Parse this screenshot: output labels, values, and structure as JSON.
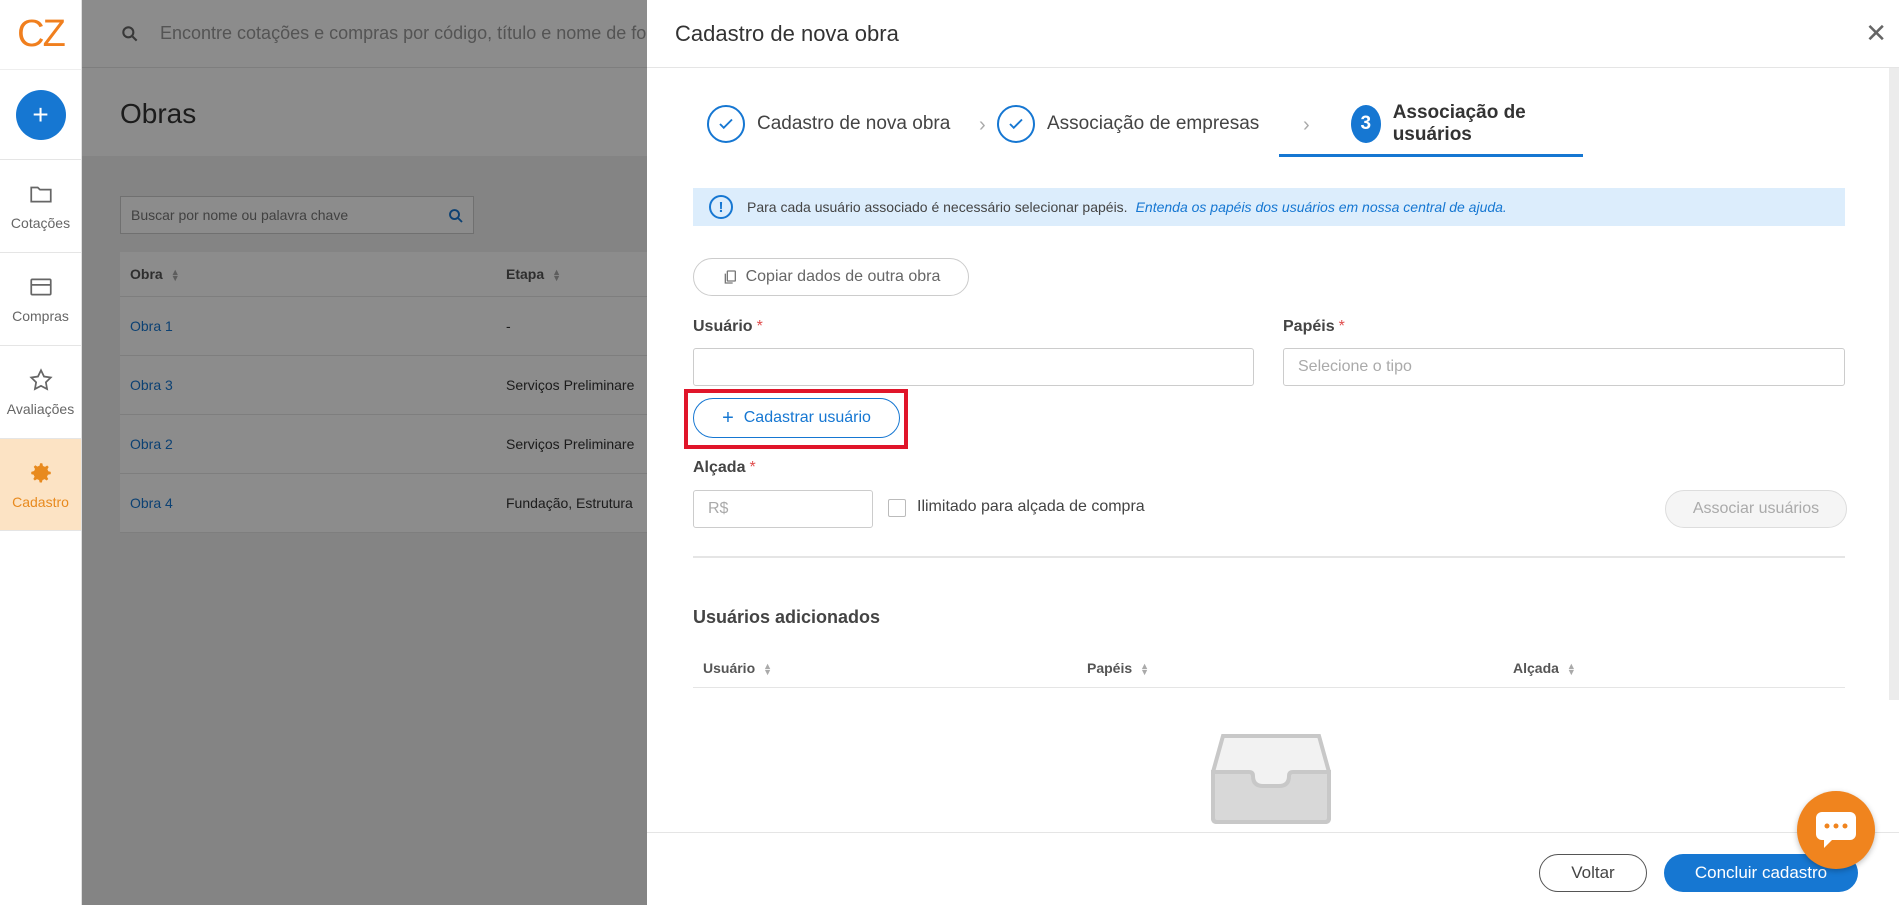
{
  "sidebar": {
    "logo": "CZ",
    "new_button": "+",
    "items": [
      {
        "label": "Cotações",
        "icon": "folder-icon"
      },
      {
        "label": "Compras",
        "icon": "card-icon"
      },
      {
        "label": "Avaliações",
        "icon": "star-icon"
      },
      {
        "label": "Cadastro",
        "icon": "gear-icon",
        "active": true
      }
    ]
  },
  "topbar": {
    "search_placeholder": "Encontre cotações e compras por código, título e nome de fo"
  },
  "page": {
    "title": "Obras",
    "search_placeholder": "Buscar por nome ou palavra chave",
    "table": {
      "columns": [
        "Obra",
        "Etapa"
      ],
      "rows": [
        {
          "obra": "Obra 1",
          "etapa": "-"
        },
        {
          "obra": "Obra 3",
          "etapa": "Serviços Preliminare"
        },
        {
          "obra": "Obra 2",
          "etapa": "Serviços Preliminare"
        },
        {
          "obra": "Obra 4",
          "etapa": "Fundação, Estrutura"
        }
      ]
    }
  },
  "drawer": {
    "title": "Cadastro de nova obra",
    "steps": [
      {
        "label": "Cadastro de nova obra",
        "state": "done"
      },
      {
        "label": "Associação de empresas",
        "state": "done"
      },
      {
        "label": "Associação de usuários",
        "state": "active",
        "number": "3"
      }
    ],
    "info": {
      "text": "Para cada usuário associado é necessário selecionar papéis.",
      "link": "Entenda os papéis dos usuários em nossa central de ajuda."
    },
    "copy_button": "Copiar dados de outra obra",
    "usuario_label": "Usuário",
    "usuario_value": "",
    "papeis_label": "Papéis",
    "papeis_placeholder": "Selecione o tipo",
    "register_button": "Cadastrar usuário",
    "alcada_label": "Alçada",
    "alcada_placeholder": "R$",
    "unlimited_label": "Ilimitado para alçada de compra",
    "associate_button": "Associar usuários",
    "added_title": "Usuários adicionados",
    "added_columns": [
      "Usuário",
      "Papéis",
      "Alçada"
    ],
    "back_button": "Voltar",
    "finish_button": "Concluir cadastro"
  },
  "colors": {
    "primary": "#1677d2",
    "accent": "#f0841e",
    "highlight": "#e0152a",
    "info_bg": "#dcedfc"
  }
}
